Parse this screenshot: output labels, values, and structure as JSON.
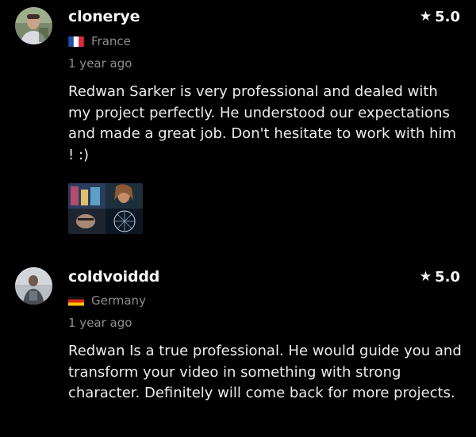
{
  "reviews": [
    {
      "username": "clonerye",
      "rating": "5.0",
      "country": "France",
      "time_ago": "1 year ago",
      "text": "Redwan Sarker is very professional and dealed with my project perfectly. He understood our expectations and made a great job. Don't hesitate to work with him ! :)",
      "flag_colors": [
        "#1f4fa8",
        "#ffffff",
        "#e3263b"
      ],
      "has_attachment": true
    },
    {
      "username": "coldvoiddd",
      "rating": "5.0",
      "country": "Germany",
      "time_ago": "1 year ago",
      "text": "Redwan Is a true professional. He would guide you and transform your video in something with strong character. Definitely will come back for more projects.",
      "flag_colors": [
        "#111111",
        "#d8261b",
        "#f6c400"
      ],
      "has_attachment": false
    }
  ],
  "icons": {
    "rating": "star-icon",
    "attachment": "video-thumbnail"
  },
  "colors": {
    "background": "#000000",
    "text_primary": "#ececec",
    "text_muted": "#8e8e8e"
  }
}
